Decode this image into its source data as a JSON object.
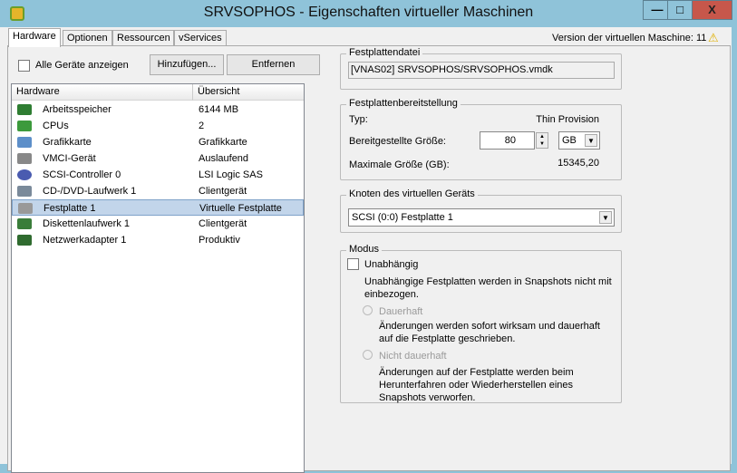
{
  "window": {
    "title": "SRVSOPHOS - Eigenschaften virtueller Maschinen",
    "minimize": "—",
    "maximize": "□",
    "close": "X"
  },
  "tabs": [
    "Hardware",
    "Optionen",
    "Ressourcen",
    "vServices"
  ],
  "version_label": "Version der virtuellen Maschine: 11",
  "toolbar": {
    "show_all": "Alle Geräte anzeigen",
    "add": "Hinzufügen...",
    "remove": "Entfernen"
  },
  "list": {
    "headers": [
      "Hardware",
      "Übersicht"
    ],
    "rows": [
      {
        "name": "Arbeitsspeicher",
        "value": "6144 MB",
        "icon": "memory-icon"
      },
      {
        "name": "CPUs",
        "value": "2",
        "icon": "cpu-icon"
      },
      {
        "name": "Grafikkarte",
        "value": "Grafikkarte",
        "icon": "monitor-icon"
      },
      {
        "name": "VMCI-Gerät",
        "value": "Auslaufend",
        "icon": "device-icon"
      },
      {
        "name": "SCSI-Controller 0",
        "value": "LSI Logic SAS",
        "icon": "scsi-icon"
      },
      {
        "name": "CD-/DVD-Laufwerk 1",
        "value": "Clientgerät",
        "icon": "cd-icon"
      },
      {
        "name": "Festplatte 1",
        "value": "Virtuelle Festplatte",
        "icon": "disk-icon"
      },
      {
        "name": "Diskettenlaufwerk 1",
        "value": "Clientgerät",
        "icon": "floppy-icon"
      },
      {
        "name": "Netzwerkadapter 1",
        "value": "Produktiv",
        "icon": "network-icon"
      }
    ]
  },
  "disk_file": {
    "label": "Festplattendatei",
    "value": "[VNAS02] SRVSOPHOS/SRVSOPHOS.vmdk"
  },
  "provisioning": {
    "label": "Festplattenbereitstellung",
    "type_label": "Typ:",
    "type_value": "Thin Provision",
    "size_label": "Bereitgestellte Größe:",
    "size_value": "80",
    "unit": "GB",
    "max_label": "Maximale Größe (GB):",
    "max_value": "15345,20"
  },
  "node": {
    "label": "Knoten des virtuellen Geräts",
    "value": "SCSI (0:0) Festplatte 1"
  },
  "mode": {
    "label": "Modus",
    "independent": "Unabhängig",
    "independent_desc": "Unabhängige Festplatten werden in Snapshots nicht mit einbezogen.",
    "persistent": "Dauerhaft",
    "persistent_desc": "Änderungen werden sofort wirksam und dauerhaft auf die Festplatte geschrieben.",
    "nonpersistent": "Nicht dauerhaft",
    "nonpersistent_desc": "Änderungen auf der Festplatte werden beim Herunterfahren oder Wiederherstellen eines Snapshots verworfen."
  }
}
